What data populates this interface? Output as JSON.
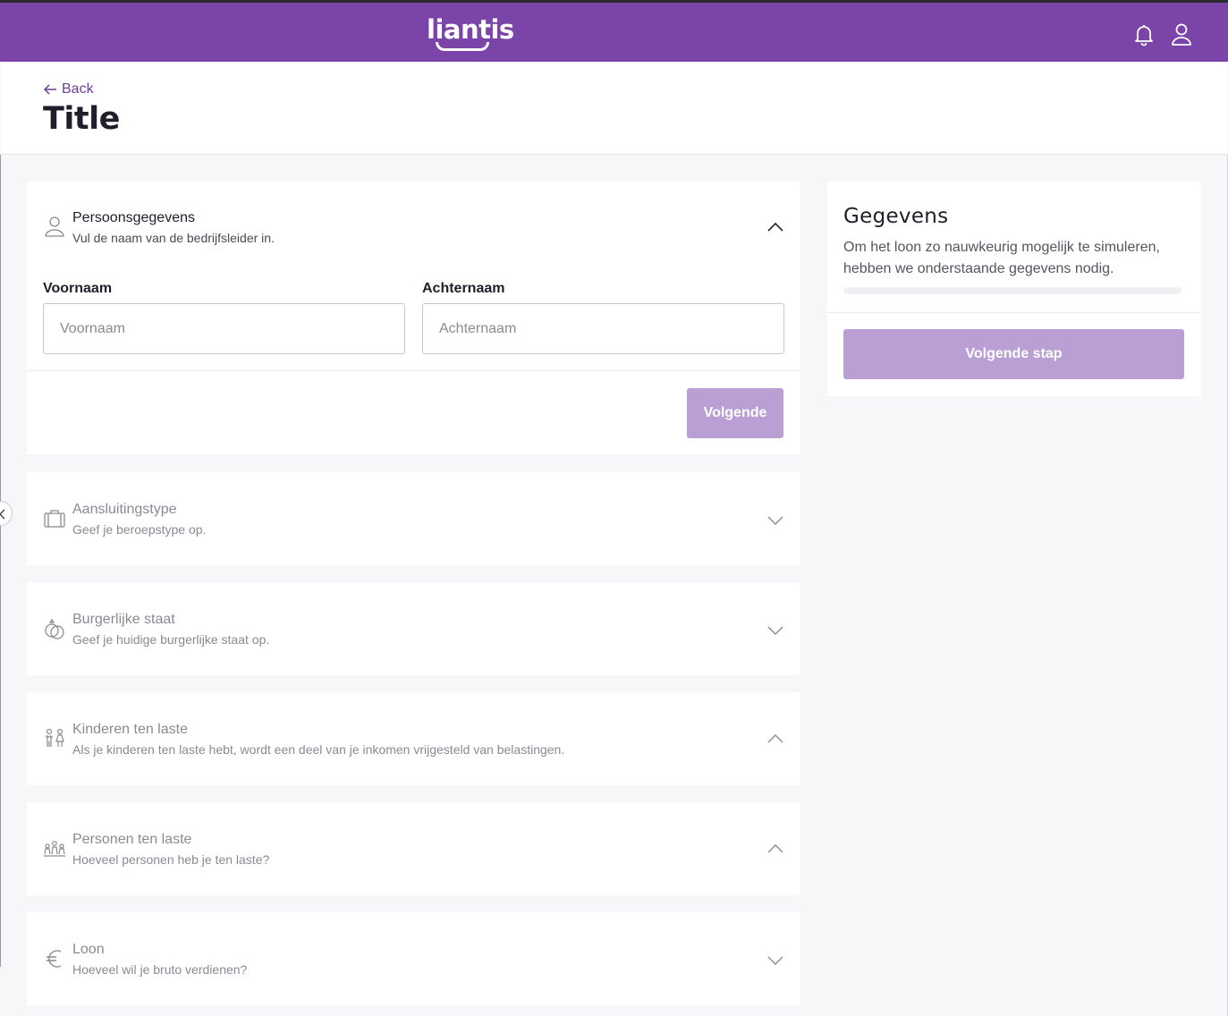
{
  "header": {
    "logo_text": "liantis",
    "icons": [
      "bell-icon",
      "user-icon"
    ],
    "brand_color": "#7b44a8"
  },
  "page": {
    "back_label": "Back",
    "title": "Title"
  },
  "form": {
    "persoonsgegevens": {
      "title": "Persoonsgegevens",
      "subtitle": "Vul de naam van de bedrijfsleider in.",
      "icon": "person-icon",
      "expanded": true,
      "first_name_label": "Voornaam",
      "first_name_placeholder": "Voornaam",
      "first_name_value": "",
      "last_name_label": "Achternaam",
      "last_name_placeholder": "Achternaam",
      "last_name_value": "",
      "next_button": "Volgende"
    },
    "sections": [
      {
        "title": "Aansluitingstype",
        "subtitle": "Geef je beroepstype op.",
        "icon": "briefcase-icon",
        "chevron": "down"
      },
      {
        "title": "Burgerlijke staat",
        "subtitle": "Geef je huidige burgerlijke staat op.",
        "icon": "rings-icon",
        "chevron": "down"
      },
      {
        "title": "Kinderen ten laste",
        "subtitle": "Als je kinderen ten laste hebt, wordt een deel van je inkomen vrijgesteld van belastingen.",
        "icon": "children-icon",
        "chevron": "up"
      },
      {
        "title": "Personen ten laste",
        "subtitle": "Hoeveel personen heb je ten laste?",
        "icon": "family-icon",
        "chevron": "up"
      },
      {
        "title": "Loon",
        "subtitle": "Hoeveel wil je bruto verdienen?",
        "icon": "euro-icon",
        "chevron": "down"
      }
    ]
  },
  "sidebar": {
    "title": "Gegevens",
    "text": "Om het loon zo nauwkeurig mogelijk te simuleren, hebben we onderstaande gegevens nodig.",
    "progress": 0,
    "button": "Volgende stap"
  }
}
